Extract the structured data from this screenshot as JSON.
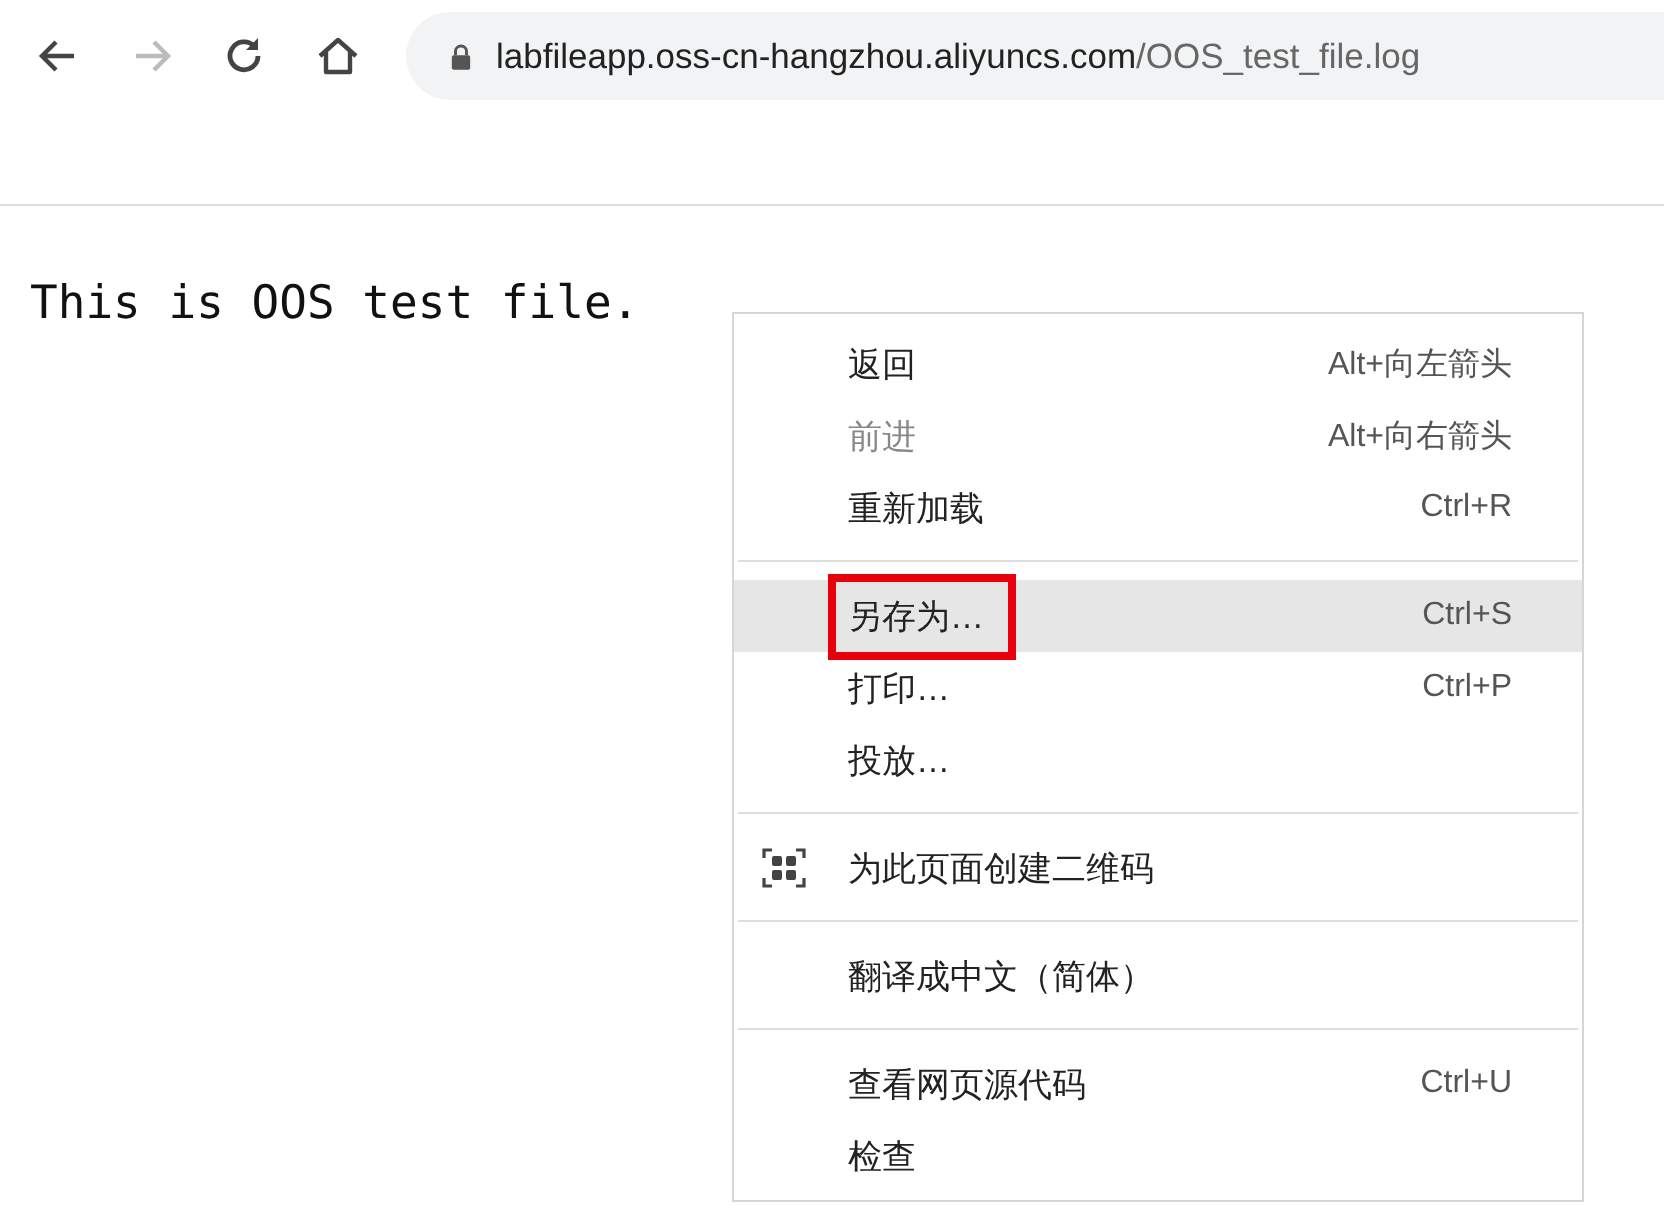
{
  "toolbar": {
    "back_disabled": false,
    "forward_disabled": true,
    "address": {
      "host": "labfileapp.oss-cn-hangzhou.aliyuncs.com",
      "path": "/OOS_test_file.log"
    }
  },
  "page": {
    "text": "This is OOS test file."
  },
  "context_menu": {
    "items": [
      {
        "kind": "item",
        "label": "返回",
        "shortcut": "Alt+向左箭头",
        "disabled": false,
        "selected": false,
        "outlined": false
      },
      {
        "kind": "item",
        "label": "前进",
        "shortcut": "Alt+向右箭头",
        "disabled": true,
        "selected": false,
        "outlined": false
      },
      {
        "kind": "item",
        "label": "重新加载",
        "shortcut": "Ctrl+R",
        "disabled": false,
        "selected": false,
        "outlined": false
      },
      {
        "kind": "separator"
      },
      {
        "kind": "item",
        "label": "另存为…",
        "shortcut": "Ctrl+S",
        "disabled": false,
        "selected": true,
        "outlined": true
      },
      {
        "kind": "item",
        "label": "打印…",
        "shortcut": "Ctrl+P",
        "disabled": false,
        "selected": false,
        "outlined": false
      },
      {
        "kind": "item",
        "label": "投放…",
        "disabled": false,
        "selected": false,
        "outlined": false
      },
      {
        "kind": "separator"
      },
      {
        "kind": "qr-item",
        "label": "为此页面创建二维码",
        "disabled": false,
        "selected": false,
        "outlined": false
      },
      {
        "kind": "separator"
      },
      {
        "kind": "item",
        "label": "翻译成中文（简体）",
        "disabled": false,
        "selected": false,
        "outlined": false
      },
      {
        "kind": "separator"
      },
      {
        "kind": "item",
        "label": "查看网页源代码",
        "shortcut": "Ctrl+U",
        "disabled": false,
        "selected": false,
        "outlined": false
      },
      {
        "kind": "item",
        "label": "检查",
        "disabled": false,
        "selected": false,
        "outlined": false
      }
    ]
  }
}
